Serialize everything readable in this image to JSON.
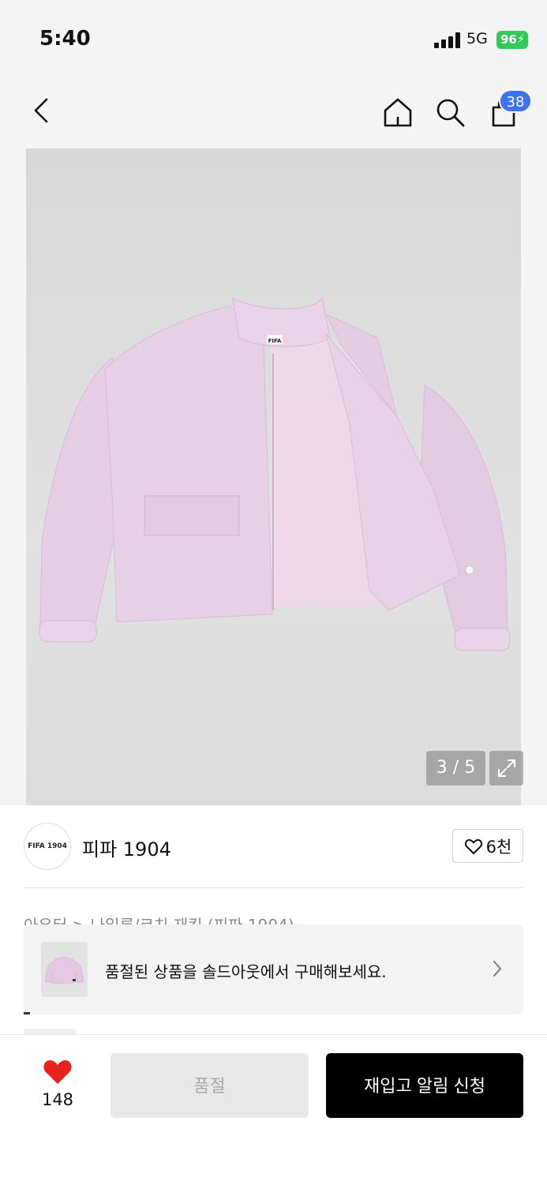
{
  "status_bar": {
    "time": "5:40",
    "network": "5G",
    "battery": "96"
  },
  "header": {
    "cart_count": "38"
  },
  "gallery": {
    "counter": "3 / 5",
    "current": 3,
    "total": 5
  },
  "brand": {
    "logo_text": "FIFA 1904",
    "name": "피파 1904",
    "likes": "6천"
  },
  "breadcrumb": "아우터 > 나일론/코치 재킷 (피파 1904)",
  "soldout_banner": {
    "text": "품절된 상품을 솔드아웃에서 구매해보세요."
  },
  "bottom_bar": {
    "wish_count": "148",
    "soldout_label": "품절",
    "restock_label": "재입고 알림 신청"
  },
  "colors": {
    "accent_blue": "#3b73f0",
    "heart_red": "#e8231d",
    "battery_green": "#34c759",
    "jacket_pink": "#e7cfe6"
  }
}
